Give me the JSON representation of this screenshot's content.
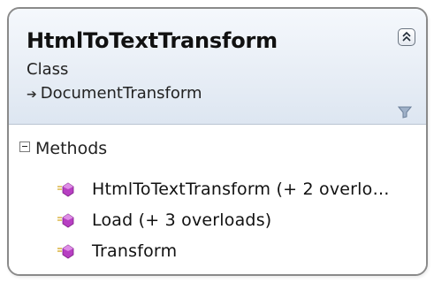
{
  "shape": {
    "title": "HtmlToTextTransform",
    "stereotype": "Class",
    "base_class": "DocumentTransform",
    "collapse_icon": "double-chevron-up-icon",
    "filter_icon": "funnel-icon"
  },
  "compartments": [
    {
      "label": "Methods",
      "toggle_icon": "minus-box-icon",
      "members": [
        {
          "label": "HtmlToTextTransform (+ 2 overlo…",
          "icon": "public-method-icon"
        },
        {
          "label": "Load (+ 3 overloads)",
          "icon": "public-method-icon"
        },
        {
          "label": "Transform",
          "icon": "public-method-icon"
        }
      ]
    }
  ],
  "colors": {
    "border": "#8a8a8a",
    "header_gradient_top": "#f5f8fc",
    "header_gradient_bottom": "#dde6f1",
    "method_icon": "#b73fc2"
  }
}
